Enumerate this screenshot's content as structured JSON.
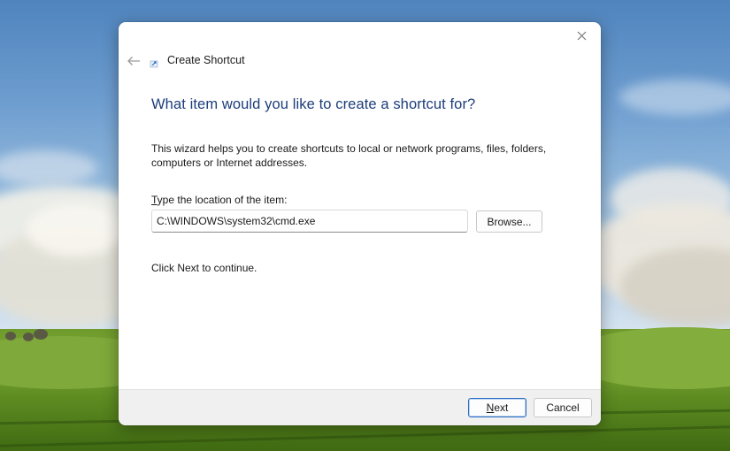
{
  "wizard": {
    "title": "Create Shortcut",
    "heading": "What item would you like to create a shortcut for?",
    "description": "This wizard helps you to create shortcuts to local or network programs, files, folders, computers or Internet addresses.",
    "location_label_accesskey": "T",
    "location_label_rest": "ype the location of the item:",
    "location_value": "C:\\WINDOWS\\system32\\cmd.exe",
    "browse_label": "Browse...",
    "continue_text": "Click Next to continue.",
    "next_accesskey": "N",
    "next_rest": "ext",
    "cancel_label": "Cancel"
  },
  "icons": {
    "close": "close-icon",
    "back": "back-arrow-icon",
    "wizard": "shortcut-wizard-icon"
  },
  "colors": {
    "heading": "#1c3d7a",
    "default_button_border": "#2b6cc4",
    "footer_bg": "#f0f0f0"
  }
}
